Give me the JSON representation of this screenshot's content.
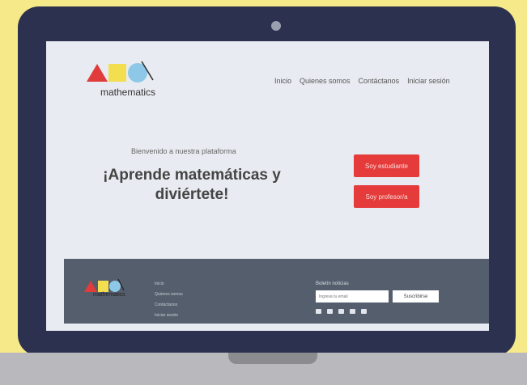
{
  "site": {
    "logo_text": "mathematics",
    "nav": [
      "Inicio",
      "Quienes somos",
      "Contáctanos",
      "Iniciar sesión"
    ]
  },
  "hero": {
    "welcome": "Bienvenido a nuestra plataforma",
    "title": "¡Aprende matemáticas y diviértete!",
    "student_button": "Soy estudiante",
    "teacher_button": "Soy profesor/a"
  },
  "footer": {
    "logo_text": "mathematics",
    "links": [
      "Inicio",
      "Quienes somos",
      "Contáctanos",
      "Iniciar sesión"
    ],
    "newsletter_label": "Boletín noticias",
    "email_placeholder": "Ingresa tu email",
    "subscribe_label": "Suscribirse",
    "social_icons": [
      "facebook-icon",
      "instagram-icon",
      "snapchat-icon",
      "twitter-icon",
      "youtube-icon"
    ]
  },
  "colors": {
    "background": "#f6e98a",
    "laptop_frame": "#2c3150",
    "screen": "#e8ebf1",
    "accent_red": "#e53b3b",
    "footer": "#545e6c"
  }
}
